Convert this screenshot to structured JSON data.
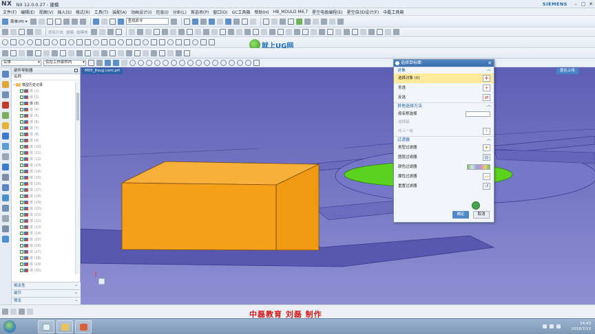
{
  "window": {
    "logo": "NX",
    "title": "NX 12.0.0.27 - 建模",
    "brand": "SIEMENS",
    "controls": [
      "–",
      "▢",
      "✕"
    ]
  },
  "menu": [
    "文件(F)",
    "编辑(E)",
    "视图(V)",
    "插入(S)",
    "格式(R)",
    "工具(T)",
    "装配(A)",
    "动画设计(I)",
    "信息(I)",
    "分析(L)",
    "首选项(P)",
    "窗口(O)",
    "GC工具箱",
    "帮助(H)",
    "HB_MOULD M6.7",
    "星空电极编程(E)",
    "星空自3D设计(F)",
    "中磊工具箱"
  ],
  "toolbar": {
    "menu_label": "菜单(M) ▾",
    "search_placeholder": "查找命令",
    "disabled_text_1": "修剪片体",
    "disabled_text_2": "拔模",
    "disabled_text_3": "拔模体",
    "disabled_text_4": "无选择过滤器"
  },
  "logo": {
    "title": "就上UG网",
    "url": "www.91ug.com"
  },
  "selection_bar": {
    "filter_type": "实体",
    "scope": "仅在工作部件内"
  },
  "navigator": {
    "title": "部件导航器",
    "column": "名称",
    "root": "模型历史记录",
    "items": [
      "体 (1)",
      "体 (2)",
      "体 (3)",
      "体 (4)",
      "体 (5)",
      "体 (6)",
      "体 (7)",
      "体 (8)",
      "体 (9)",
      "体 (10)",
      "体 (11)",
      "体 (12)",
      "体 (13)",
      "体 (14)",
      "体 (15)",
      "体 (16)",
      "体 (17)",
      "体 (18)",
      "体 (19)",
      "体 (20)",
      "体 (21)",
      "体 (22)",
      "体 (23)",
      "体 (24)",
      "体 (25)",
      "体 (26)",
      "体 (27)",
      "体 (28)",
      "体 (29)",
      "体 (30)"
    ],
    "panes": [
      "相关性",
      "细节",
      "预览"
    ]
  },
  "graphics": {
    "tab": "M05_Jtsug.com.prt",
    "fullscreen": "现在上传"
  },
  "dialog": {
    "title": "选择目标面",
    "section_object": "对象",
    "select_object": "选择对象 (0)",
    "select_all": "全选",
    "invert": "反选",
    "section_other": "其他选择方法",
    "by_name": "按名称选择",
    "select_chain": "选择链",
    "up_one_level": "向上一级",
    "section_filter": "过滤器",
    "type_filter": "类型过滤器",
    "layer_filter": "图层过滤器",
    "color_filter": "颜色过滤器",
    "attribute_filter": "属性过滤器",
    "reset_filter": "重置过滤器",
    "ok": "确定",
    "cancel": "取消"
  },
  "caption": "中磊教育  刘磊  制作",
  "taskbar": {
    "time": "14:43",
    "date": "2018/7/13"
  },
  "colors": {
    "solid": "#f5a019",
    "floor": "#6f71c4",
    "green_disk": "#5bd21f"
  }
}
